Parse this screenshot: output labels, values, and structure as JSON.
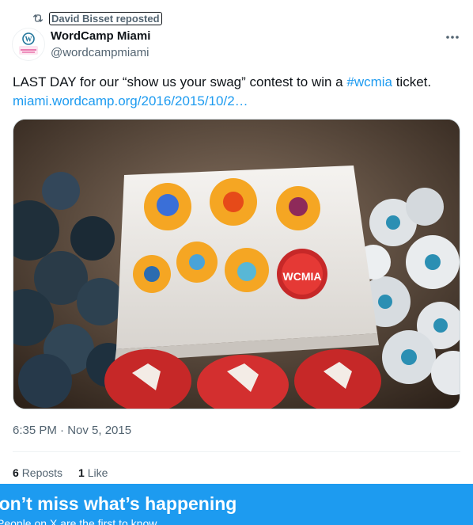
{
  "repost": {
    "label": "David Bisset reposted",
    "icon": "repost-icon"
  },
  "author": {
    "name": "WordCamp Miami",
    "handle": "@wordcampmiami",
    "avatar_text": "WORDCAMP MIAMI 2016",
    "avatar_color": "#e03c8a"
  },
  "tweet": {
    "text_before": "LAST DAY for our “show us your swag” contest to win a ",
    "hashtag": "#wcmia",
    "text_after": " ticket.",
    "url": "miami.wordcamp.org/2016/2015/10/2…",
    "timestamp": "6:35 PM · Nov 5, 2015"
  },
  "media": {
    "sticker_text": "WCMIA"
  },
  "stats": {
    "reposts_count": "6",
    "reposts_label": "Reposts",
    "likes_count": "1",
    "likes_label": "Like"
  },
  "banner": {
    "title": "Don’t miss what’s happening",
    "subtitle": "People on X are the first to know."
  },
  "colors": {
    "accent": "#1d9bf0",
    "text": "#0f1419",
    "muted": "#536471"
  }
}
